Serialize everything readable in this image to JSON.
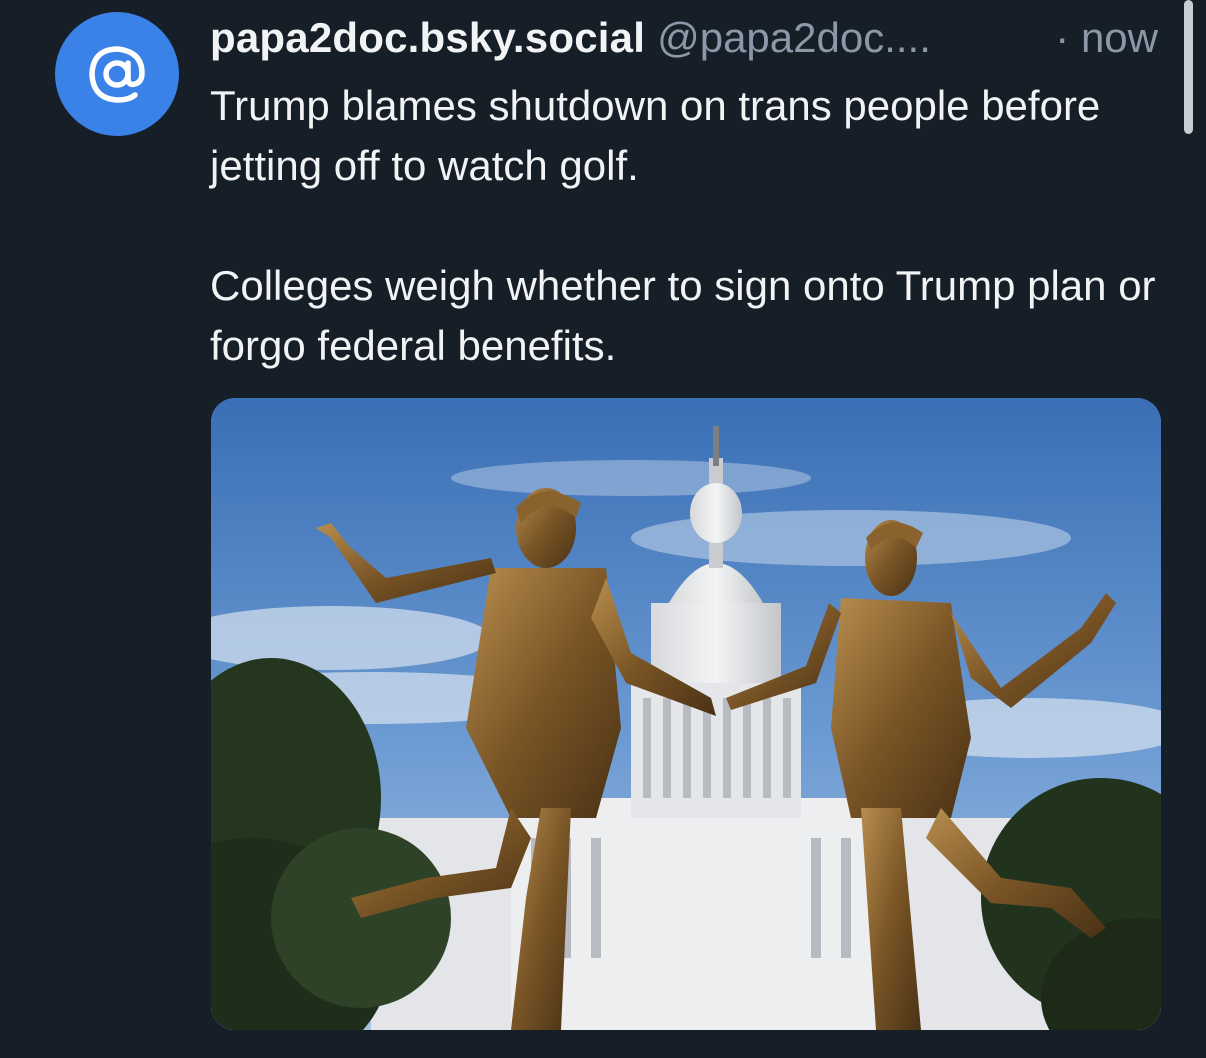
{
  "post": {
    "avatar_icon": "at-sign-icon",
    "display_name": "papa2doc.bsky.social",
    "handle": "@papa2doc....",
    "timestamp": "· now",
    "paragraphs": [
      "Trump blames shutdown on trans people before jetting off to watch golf.",
      "Colleges weigh whether to sign onto Trump plan or forgo federal benefits."
    ],
    "media": {
      "kind": "photo",
      "subject": "bronze-statue-photo"
    }
  },
  "colors": {
    "background": "#161e27",
    "avatar": "#3b82e8",
    "text_primary": "#f1f3f5",
    "text_secondary": "#8c98a7",
    "scrollbar": "#c9ced5"
  }
}
